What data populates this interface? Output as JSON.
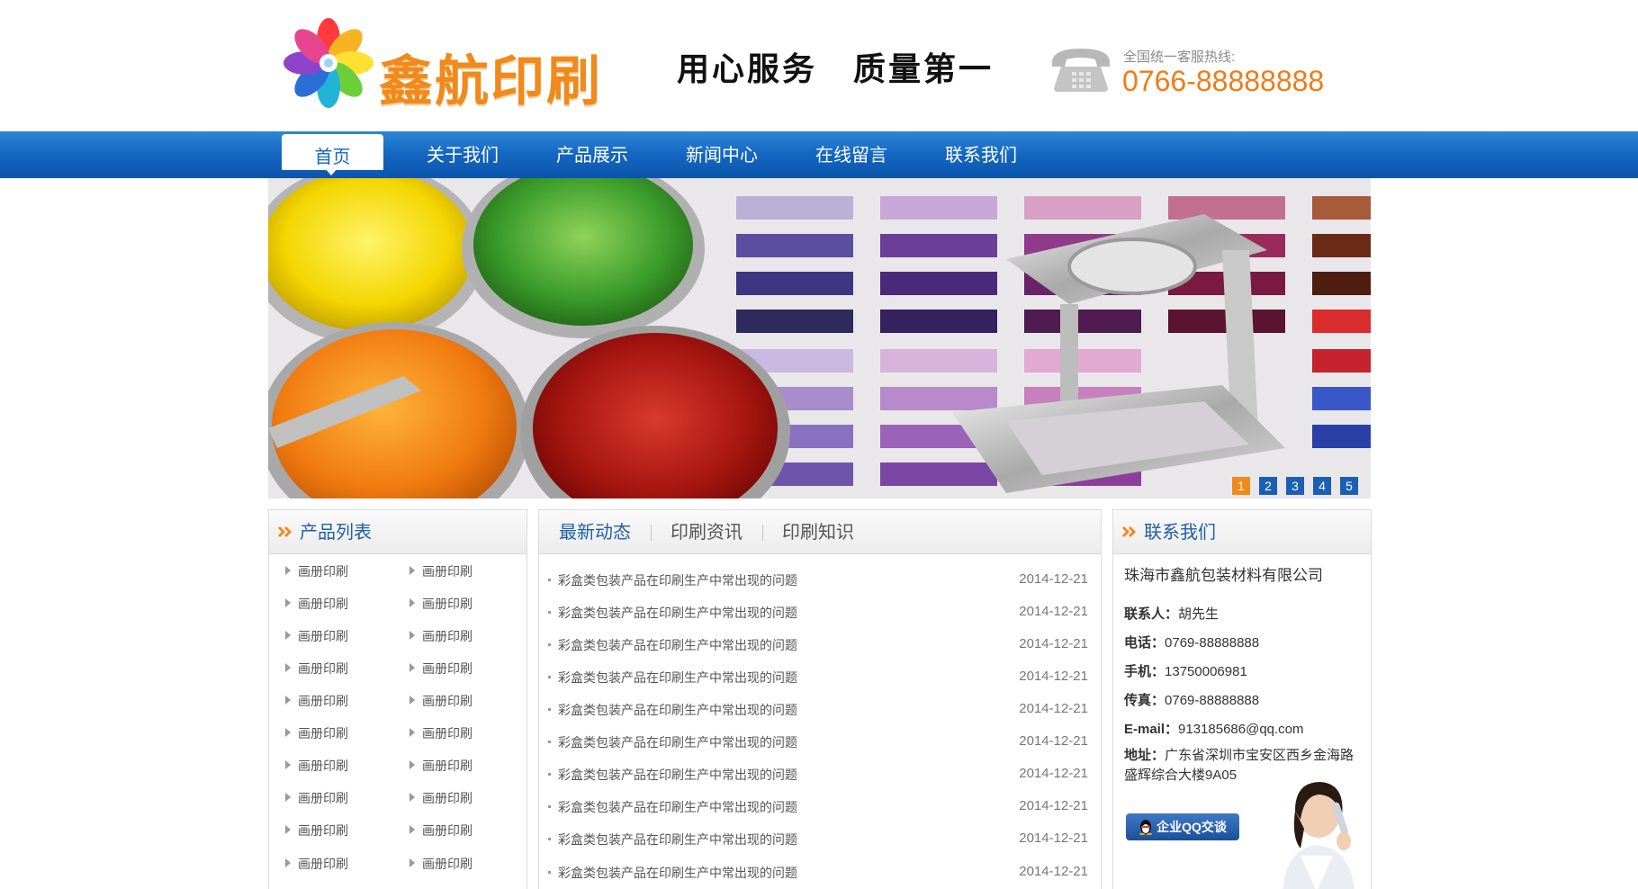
{
  "header": {
    "logo_text": "鑫航印刷",
    "slogan_left": "用心服务",
    "slogan_right": "质量第一",
    "hotline_label": "全国统一客服热线:",
    "hotline_number": "0766-88888888"
  },
  "nav": {
    "items": [
      {
        "label": "首页",
        "active": true
      },
      {
        "label": "关于我们",
        "active": false
      },
      {
        "label": "产品展示",
        "active": false
      },
      {
        "label": "新闻中心",
        "active": false
      },
      {
        "label": "在线留言",
        "active": false
      },
      {
        "label": "联系我们",
        "active": false
      }
    ]
  },
  "banner": {
    "slides": [
      "1",
      "2",
      "3",
      "4",
      "5"
    ],
    "active_slide": 1
  },
  "products": {
    "title": "产品列表",
    "items": [
      "画册印刷",
      "画册印刷",
      "画册印刷",
      "画册印刷",
      "画册印刷",
      "画册印刷",
      "画册印刷",
      "画册印刷",
      "画册印刷",
      "画册印刷",
      "画册印刷",
      "画册印刷",
      "画册印刷",
      "画册印刷",
      "画册印刷",
      "画册印刷",
      "画册印刷",
      "画册印刷",
      "画册印刷",
      "画册印刷"
    ]
  },
  "news": {
    "tabs": [
      "最新动态",
      "印刷资讯",
      "印刷知识"
    ],
    "active_tab": 0,
    "items": [
      {
        "title": "彩盒类包装产品在印刷生产中常出现的问题",
        "date": "2014-12-21"
      },
      {
        "title": "彩盒类包装产品在印刷生产中常出现的问题",
        "date": "2014-12-21"
      },
      {
        "title": "彩盒类包装产品在印刷生产中常出现的问题",
        "date": "2014-12-21"
      },
      {
        "title": "彩盒类包装产品在印刷生产中常出现的问题",
        "date": "2014-12-21"
      },
      {
        "title": "彩盒类包装产品在印刷生产中常出现的问题",
        "date": "2014-12-21"
      },
      {
        "title": "彩盒类包装产品在印刷生产中常出现的问题",
        "date": "2014-12-21"
      },
      {
        "title": "彩盒类包装产品在印刷生产中常出现的问题",
        "date": "2014-12-21"
      },
      {
        "title": "彩盒类包装产品在印刷生产中常出现的问题",
        "date": "2014-12-21"
      },
      {
        "title": "彩盒类包装产品在印刷生产中常出现的问题",
        "date": "2014-12-21"
      },
      {
        "title": "彩盒类包装产品在印刷生产中常出现的问题",
        "date": "2014-12-21"
      }
    ]
  },
  "contact": {
    "title": "联系我们",
    "company": "珠海市鑫航包装材料有限公司",
    "lines": [
      {
        "label": "联系人：",
        "value": "胡先生"
      },
      {
        "label": "电话：",
        "value": "0769-88888888"
      },
      {
        "label": "手机：",
        "value": "13750006981"
      },
      {
        "label": "传真：",
        "value": "0769-88888888"
      },
      {
        "label": "E-mail：",
        "value": "913185686@qq.com"
      }
    ],
    "address_label": "地址：",
    "address_value": "广东省深圳市宝安区西乡金海路盛辉综合大楼9A05",
    "qq_button": "企业QQ交谈"
  },
  "colors": {
    "brand_orange": "#f08a1c",
    "nav_blue": "#1466c0",
    "title_blue": "#1e5fa8"
  }
}
